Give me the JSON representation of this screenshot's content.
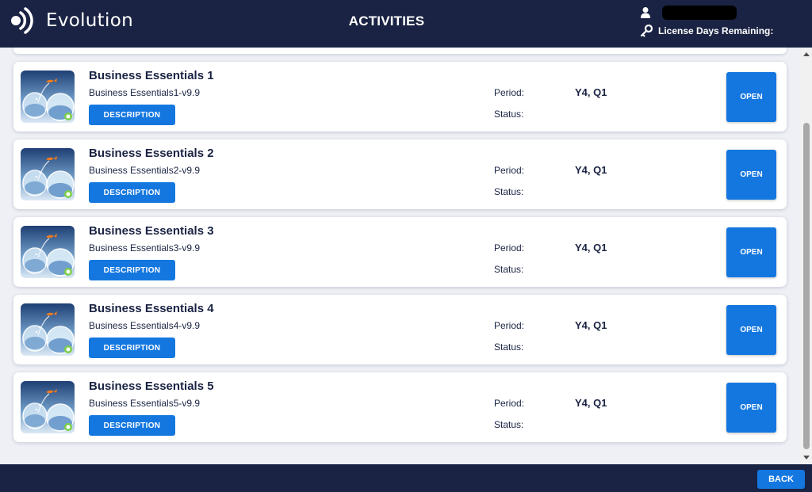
{
  "header": {
    "brand": "Evolution",
    "title": "ACTIVITIES",
    "user_name": "",
    "license_label": "License Days Remaining:"
  },
  "activities": [
    {
      "title": "Business Essentials 1",
      "subtitle": "Business Essentials1-v9.9",
      "description_label": "DESCRIPTION",
      "period_label": "Period:",
      "period_value": "Y4, Q1",
      "status_label": "Status:",
      "open_label": "OPEN"
    },
    {
      "title": "Business Essentials 2",
      "subtitle": "Business Essentials2-v9.9",
      "description_label": "DESCRIPTION",
      "period_label": "Period:",
      "period_value": "Y4, Q1",
      "status_label": "Status:",
      "open_label": "OPEN"
    },
    {
      "title": "Business Essentials 3",
      "subtitle": "Business Essentials3-v9.9",
      "description_label": "DESCRIPTION",
      "period_label": "Period:",
      "period_value": "Y4, Q1",
      "status_label": "Status:",
      "open_label": "OPEN"
    },
    {
      "title": "Business Essentials 4",
      "subtitle": "Business Essentials4-v9.9",
      "description_label": "DESCRIPTION",
      "period_label": "Period:",
      "period_value": "Y4, Q1",
      "status_label": "Status:",
      "open_label": "OPEN"
    },
    {
      "title": "Business Essentials 5",
      "subtitle": "Business Essentials5-v9.9",
      "description_label": "DESCRIPTION",
      "period_label": "Period:",
      "period_value": "Y4, Q1",
      "status_label": "Status:",
      "open_label": "OPEN"
    }
  ],
  "footer": {
    "back_label": "BACK"
  },
  "colors": {
    "header_bg": "#1a2343",
    "accent": "#1477e0",
    "content_bg": "#eef0f5"
  },
  "icons": [
    "evolution-logo-icon",
    "user-icon",
    "key-icon",
    "goldfish-jump-icon"
  ]
}
